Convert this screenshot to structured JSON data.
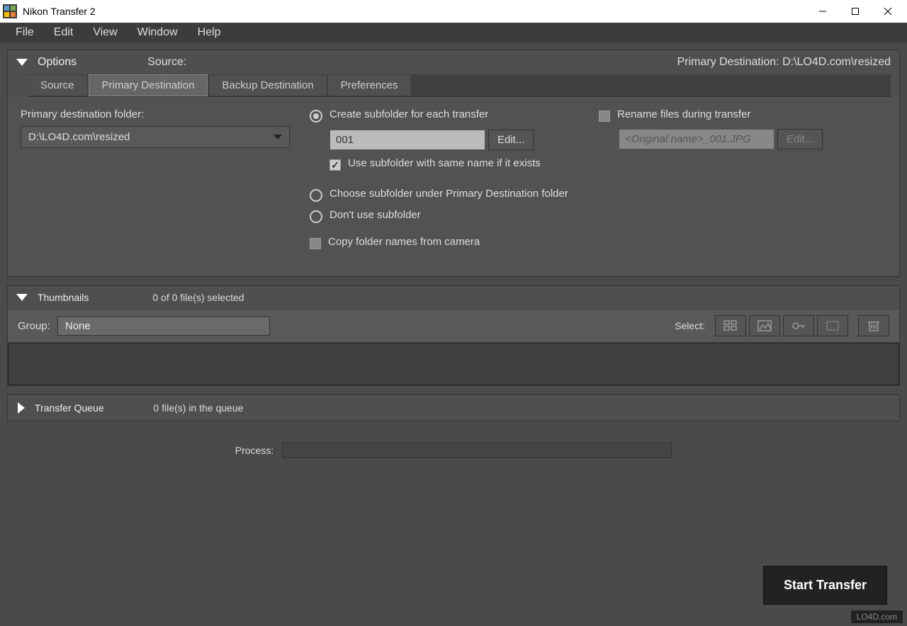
{
  "window": {
    "title": "Nikon Transfer 2"
  },
  "menu": {
    "file": "File",
    "edit": "Edit",
    "view": "View",
    "window": "Window",
    "help": "Help"
  },
  "options": {
    "title": "Options",
    "source_label": "Source:",
    "primary_dest_label": "Primary Destination:",
    "primary_dest_value": "D:\\LO4D.com\\resized",
    "tabs": {
      "source": "Source",
      "primary": "Primary Destination",
      "backup": "Backup Destination",
      "prefs": "Preferences"
    },
    "folder_label": "Primary destination folder:",
    "folder_value": "D:\\LO4D.com\\resized",
    "create_subfolder": "Create subfolder for each transfer",
    "subfolder_value": "001",
    "edit_btn": "Edit...",
    "use_same_name": "Use subfolder with same name if it exists",
    "choose_subfolder": "Choose subfolder under Primary Destination folder",
    "dont_use": "Don't use subfolder",
    "copy_names": "Copy folder names from camera",
    "rename_files": "Rename files during transfer",
    "rename_value": "<Original name>_001.JPG"
  },
  "thumbnails": {
    "title": "Thumbnails",
    "count": "0 of 0 file(s) selected",
    "group_label": "Group:",
    "group_value": "None",
    "select_label": "Select:"
  },
  "queue": {
    "title": "Transfer Queue",
    "count": "0 file(s) in the queue"
  },
  "process": {
    "label": "Process:"
  },
  "start": "Start Transfer",
  "watermark": "LO4D.com"
}
